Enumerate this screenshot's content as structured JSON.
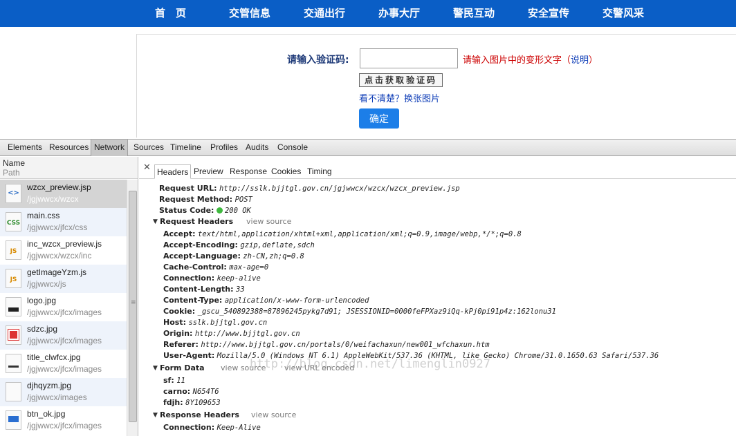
{
  "nav": {
    "items": [
      "首　页",
      "交管信息",
      "交通出行",
      "办事大厅",
      "警民互动",
      "安全宣传",
      "交警风采"
    ]
  },
  "captcha": {
    "label": "请输入验证码:",
    "input_value": "",
    "hint": "请输入图片中的变形文字",
    "hint_open": "（",
    "explain_link": "说明",
    "hint_close": "）",
    "image_text": "点击获取验证码",
    "refresh_text": "看不清楚？换张图片",
    "confirm_label": "确定"
  },
  "devtools": {
    "panels": [
      "Elements",
      "Resources",
      "Network",
      "Sources",
      "Timeline",
      "Profiles",
      "Audits",
      "Console"
    ],
    "active_panel": "Network",
    "list_header": {
      "name": "Name",
      "path": "Path"
    },
    "requests": [
      {
        "name": "wzcx_preview.jsp",
        "path": "/jgjwwcx/wzcx",
        "icon": "html-file-icon",
        "icon_label": "<>",
        "selected": true
      },
      {
        "name": "main.css",
        "path": "/jgjwwcx/jfcx/css",
        "icon": "css-file-icon",
        "icon_label": "CSS"
      },
      {
        "name": "inc_wzcx_preview.js",
        "path": "/jgjwwcx/wzcx/inc",
        "icon": "js-file-icon",
        "icon_label": "JS"
      },
      {
        "name": "getImageYzm.js",
        "path": "/jgjwwcx/js",
        "icon": "js-file-icon",
        "icon_label": "JS"
      },
      {
        "name": "logo.jpg",
        "path": "/jgjwwcx/jfcx/images",
        "icon": "image-file-icon",
        "icon_label": ""
      },
      {
        "name": "sdzc.jpg",
        "path": "/jgjwwcx/jfcx/images",
        "icon": "image-file-icon",
        "icon_label": ""
      },
      {
        "name": "title_clwfcx.jpg",
        "path": "/jgjwwcx/jfcx/images",
        "icon": "image-file-icon",
        "icon_label": ""
      },
      {
        "name": "djhqyzm.jpg",
        "path": "/jgjwwcx/images",
        "icon": "image-file-icon",
        "icon_label": ""
      },
      {
        "name": "btn_ok.jpg",
        "path": "/jgjwwcx/jfcx/images",
        "icon": "image-file-icon",
        "icon_label": ""
      }
    ],
    "detail_tabs": [
      "Headers",
      "Preview",
      "Response",
      "Cookies",
      "Timing"
    ],
    "active_detail_tab": "Headers",
    "general": {
      "request_url_key": "Request URL:",
      "request_url": "http://sslk.bjjtgl.gov.cn/jgjwwcx/wzcx/wzcx_preview.jsp",
      "request_method_key": "Request Method:",
      "request_method": "POST",
      "status_code_key": "Status Code:",
      "status_code": "200 OK"
    },
    "request_headers": {
      "title": "Request Headers",
      "view_source": "view source",
      "items": [
        {
          "key": "Accept:",
          "value": "text/html,application/xhtml+xml,application/xml;q=0.9,image/webp,*/*;q=0.8"
        },
        {
          "key": "Accept-Encoding:",
          "value": "gzip,deflate,sdch"
        },
        {
          "key": "Accept-Language:",
          "value": "zh-CN,zh;q=0.8"
        },
        {
          "key": "Cache-Control:",
          "value": "max-age=0"
        },
        {
          "key": "Connection:",
          "value": "keep-alive"
        },
        {
          "key": "Content-Length:",
          "value": "33"
        },
        {
          "key": "Content-Type:",
          "value": "application/x-www-form-urlencoded"
        },
        {
          "key": "Cookie:",
          "value": "_gscu_540892388=87896245pykg7d91; JSESSIONID=0000feFPXaz9iQq-kPj0pi91p4z:162lonu31"
        },
        {
          "key": "Host:",
          "value": "sslk.bjjtgl.gov.cn"
        },
        {
          "key": "Origin:",
          "value": "http://www.bjjtgl.gov.cn"
        },
        {
          "key": "Referer:",
          "value": "http://www.bjjtgl.gov.cn/portals/0/weifachaxun/new001_wfchaxun.htm"
        },
        {
          "key": "User-Agent:",
          "value": "Mozilla/5.0 (Windows NT 6.1) AppleWebKit/537.36 (KHTML, like Gecko) Chrome/31.0.1650.63 Safari/537.36"
        }
      ]
    },
    "form_data": {
      "title": "Form Data",
      "view_source": "view source",
      "view_url_encoded": "view URL encoded",
      "items": [
        {
          "key": "sf:",
          "value": "11"
        },
        {
          "key": "carno:",
          "value": "N654T6"
        },
        {
          "key": "fdjh:",
          "value": "8Y109653"
        }
      ]
    },
    "response_headers": {
      "title": "Response Headers",
      "view_source": "view source",
      "items": [
        {
          "key": "Connection:",
          "value": "Keep-Alive"
        }
      ]
    },
    "watermark": "http://blog.csdn.net/limenglin0927"
  },
  "colors": {
    "nav_bg": "#0a5ec6",
    "accent_blue": "#1c7ee8",
    "hint_red": "#cc0000",
    "status_ok": "#3fb93f"
  }
}
